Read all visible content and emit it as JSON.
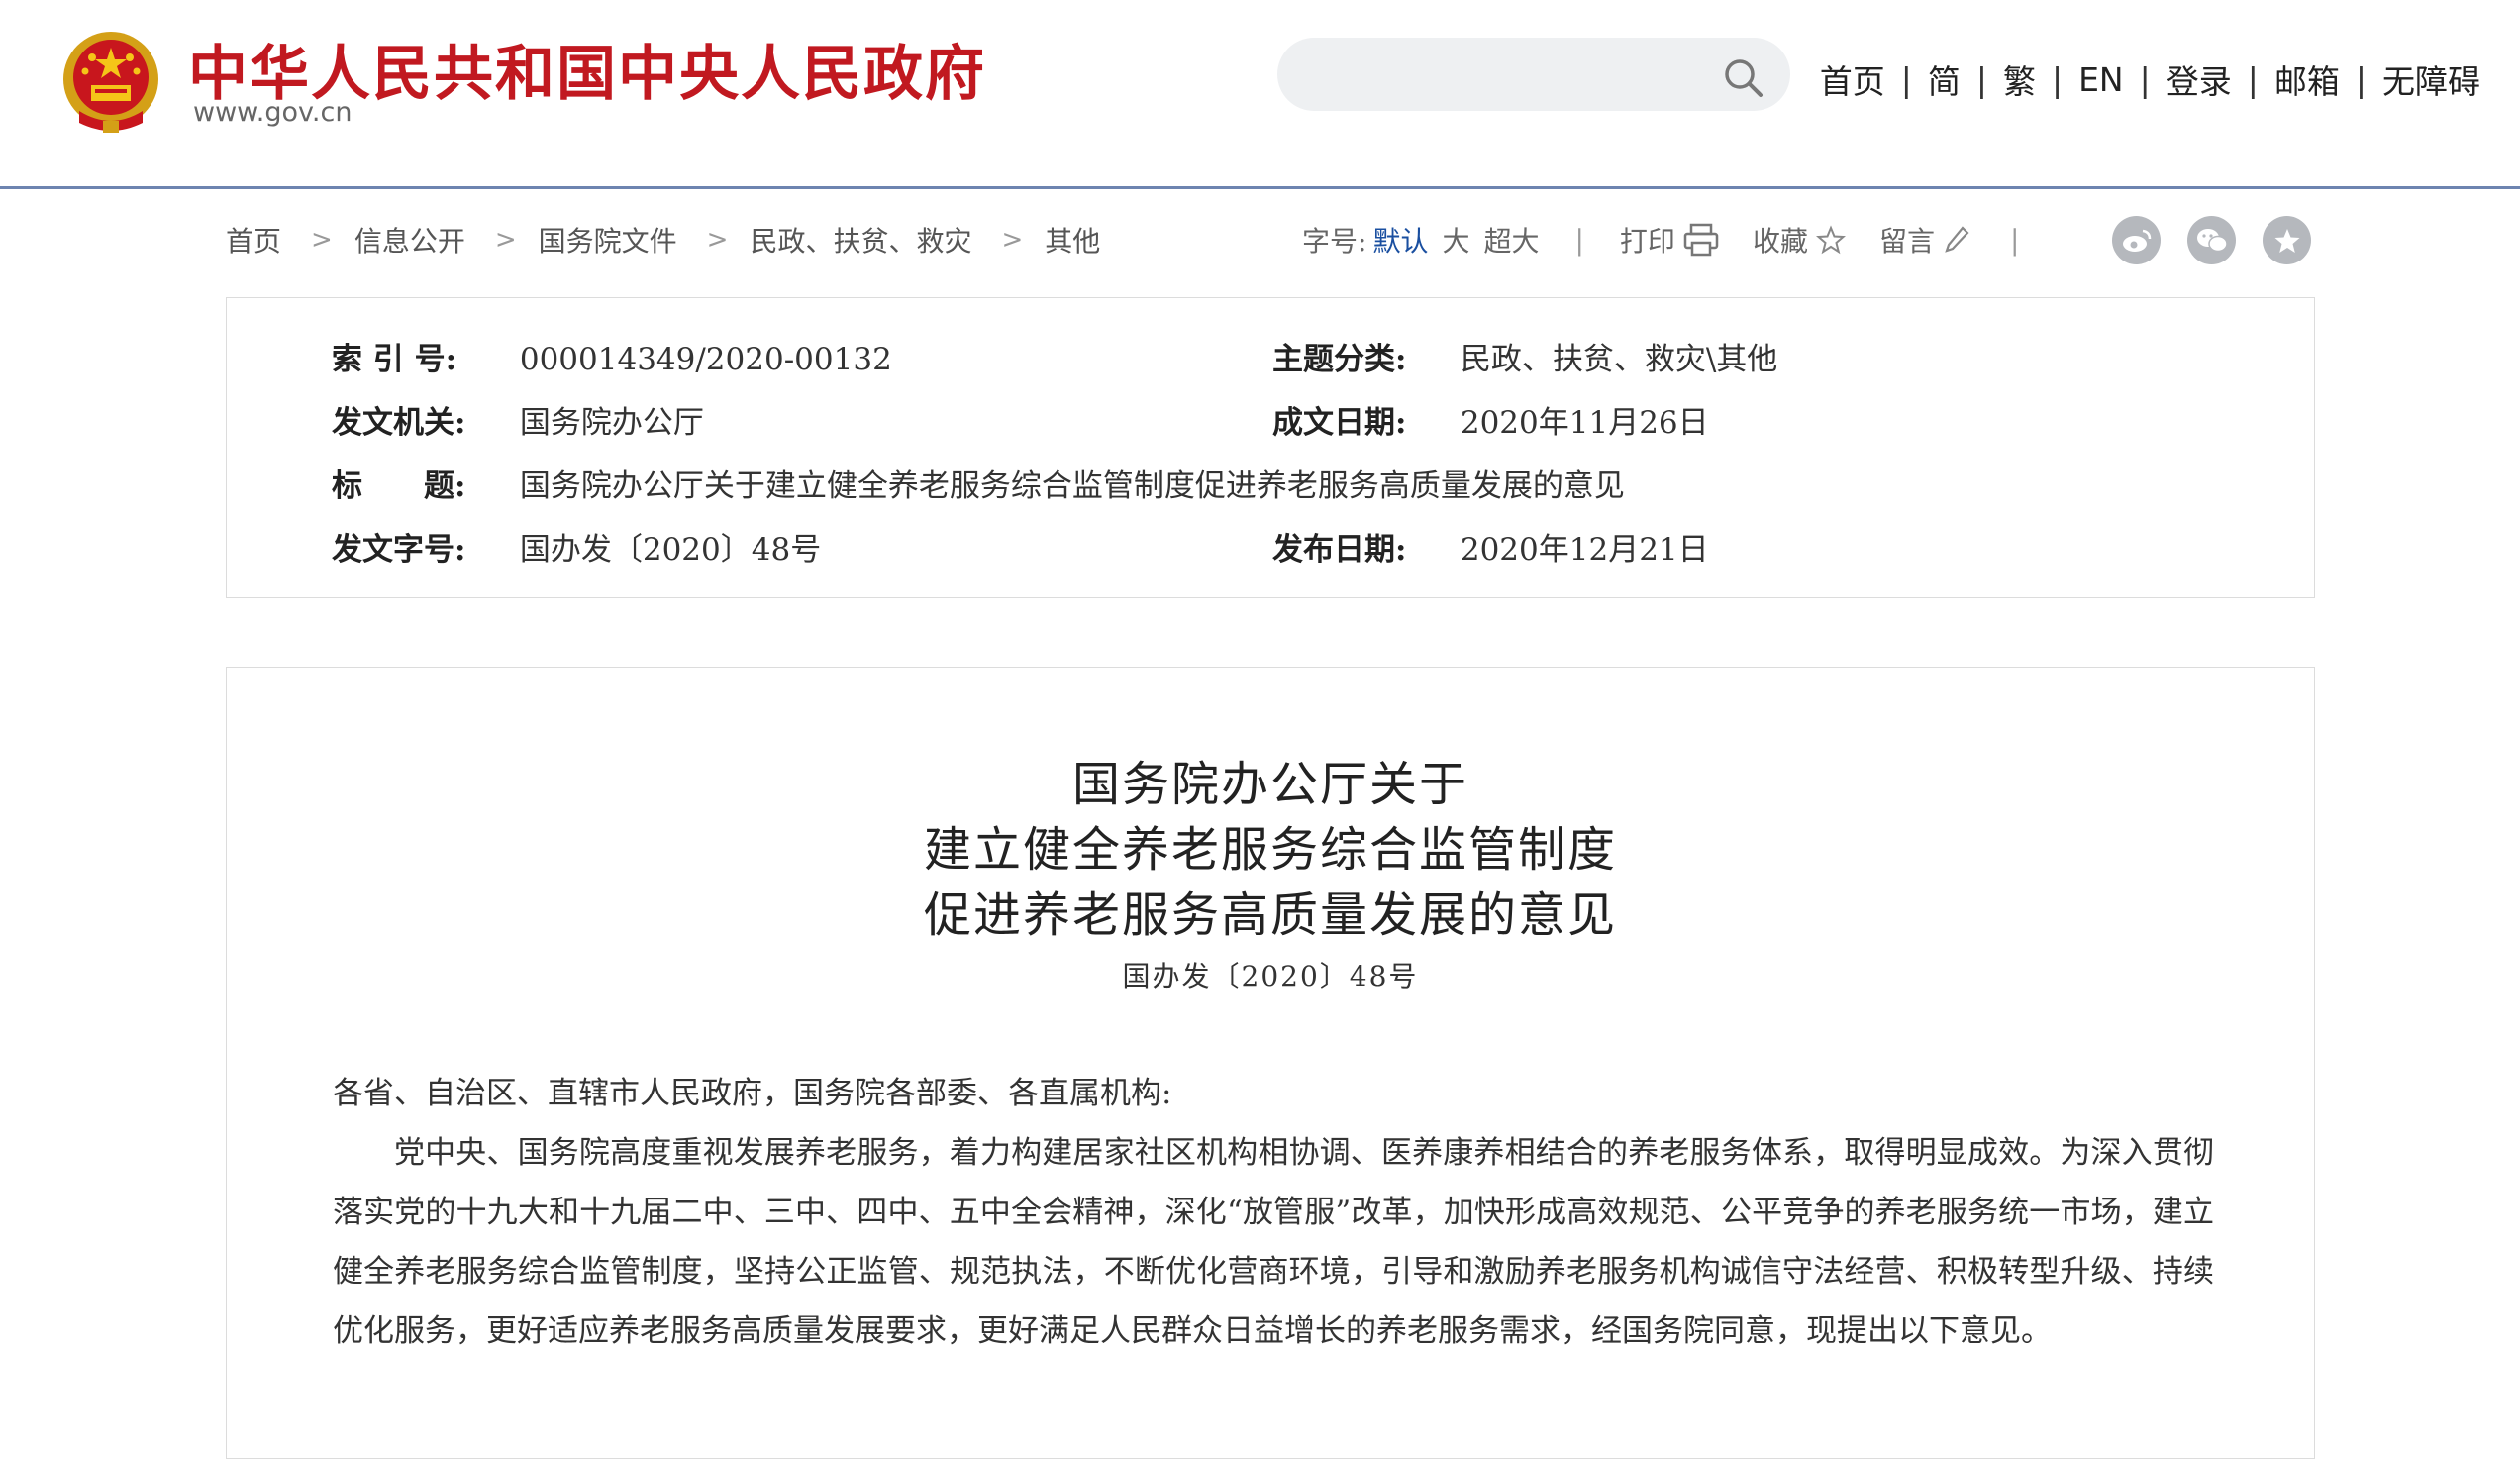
{
  "header": {
    "site_title": "中华人民共和国中央人民政府",
    "site_domain": "www.gov.cn",
    "search_placeholder": "",
    "nav": [
      "首页",
      "简",
      "繁",
      "EN",
      "登录",
      "邮箱",
      "无障碍"
    ]
  },
  "breadcrumb": [
    "首页",
    "信息公开",
    "国务院文件",
    "民政、扶贫、救灾",
    "其他"
  ],
  "tools": {
    "font_label": "字号:",
    "font_default": "默认",
    "font_large": "大",
    "font_xlarge": "超大",
    "print": "打印",
    "favorite": "收藏",
    "comment": "留言"
  },
  "social_icons": [
    "weibo-icon",
    "wechat-icon",
    "star-share-icon"
  ],
  "info": {
    "index_label": "索 引 号:",
    "index_value": "000014349/2020-00132",
    "category_label": "主题分类:",
    "category_value": "民政、扶贫、救灾\\其他",
    "issuer_label": "发文机关:",
    "issuer_value": "国务院办公厅",
    "written_date_label": "成文日期:",
    "written_date_value": "2020年11月26日",
    "title_label": "标　　题:",
    "title_value": "国务院办公厅关于建立健全养老服务综合监管制度促进养老服务高质量发展的意见",
    "doc_no_label": "发文字号:",
    "doc_no_value": "国办发〔2020〕48号",
    "publish_date_label": "发布日期:",
    "publish_date_value": "2020年12月21日"
  },
  "article": {
    "title_lines": [
      "国务院办公厅关于",
      "建立健全养老服务综合监管制度",
      "促进养老服务高质量发展的意见"
    ],
    "doc_number": "国办发〔2020〕48号",
    "salutation": "各省、自治区、直辖市人民政府，国务院各部委、各直属机构:",
    "paragraph": "党中央、国务院高度重视发展养老服务，着力构建居家社区机构相协调、医养康养相结合的养老服务体系，取得明显成效。为深入贯彻落实党的十九大和十九届二中、三中、四中、五中全会精神，深化“放管服”改革，加快形成高效规范、公平竞争的养老服务统一市场，建立健全养老服务综合监管制度，坚持公正监管、规范执法，不断优化营商环境，引导和激励养老服务机构诚信守法经营、积极转型升级、持续优化服务，更好适应养老服务高质量发展要求，更好满足人民群众日益增长的养老服务需求，经国务院同意，现提出以下意见。"
  },
  "colors": {
    "brand_red": "#c11920",
    "header_rule": "#6d84b0",
    "link_blue": "#1a4fa0",
    "icon_gray": "#b5b8bd"
  }
}
